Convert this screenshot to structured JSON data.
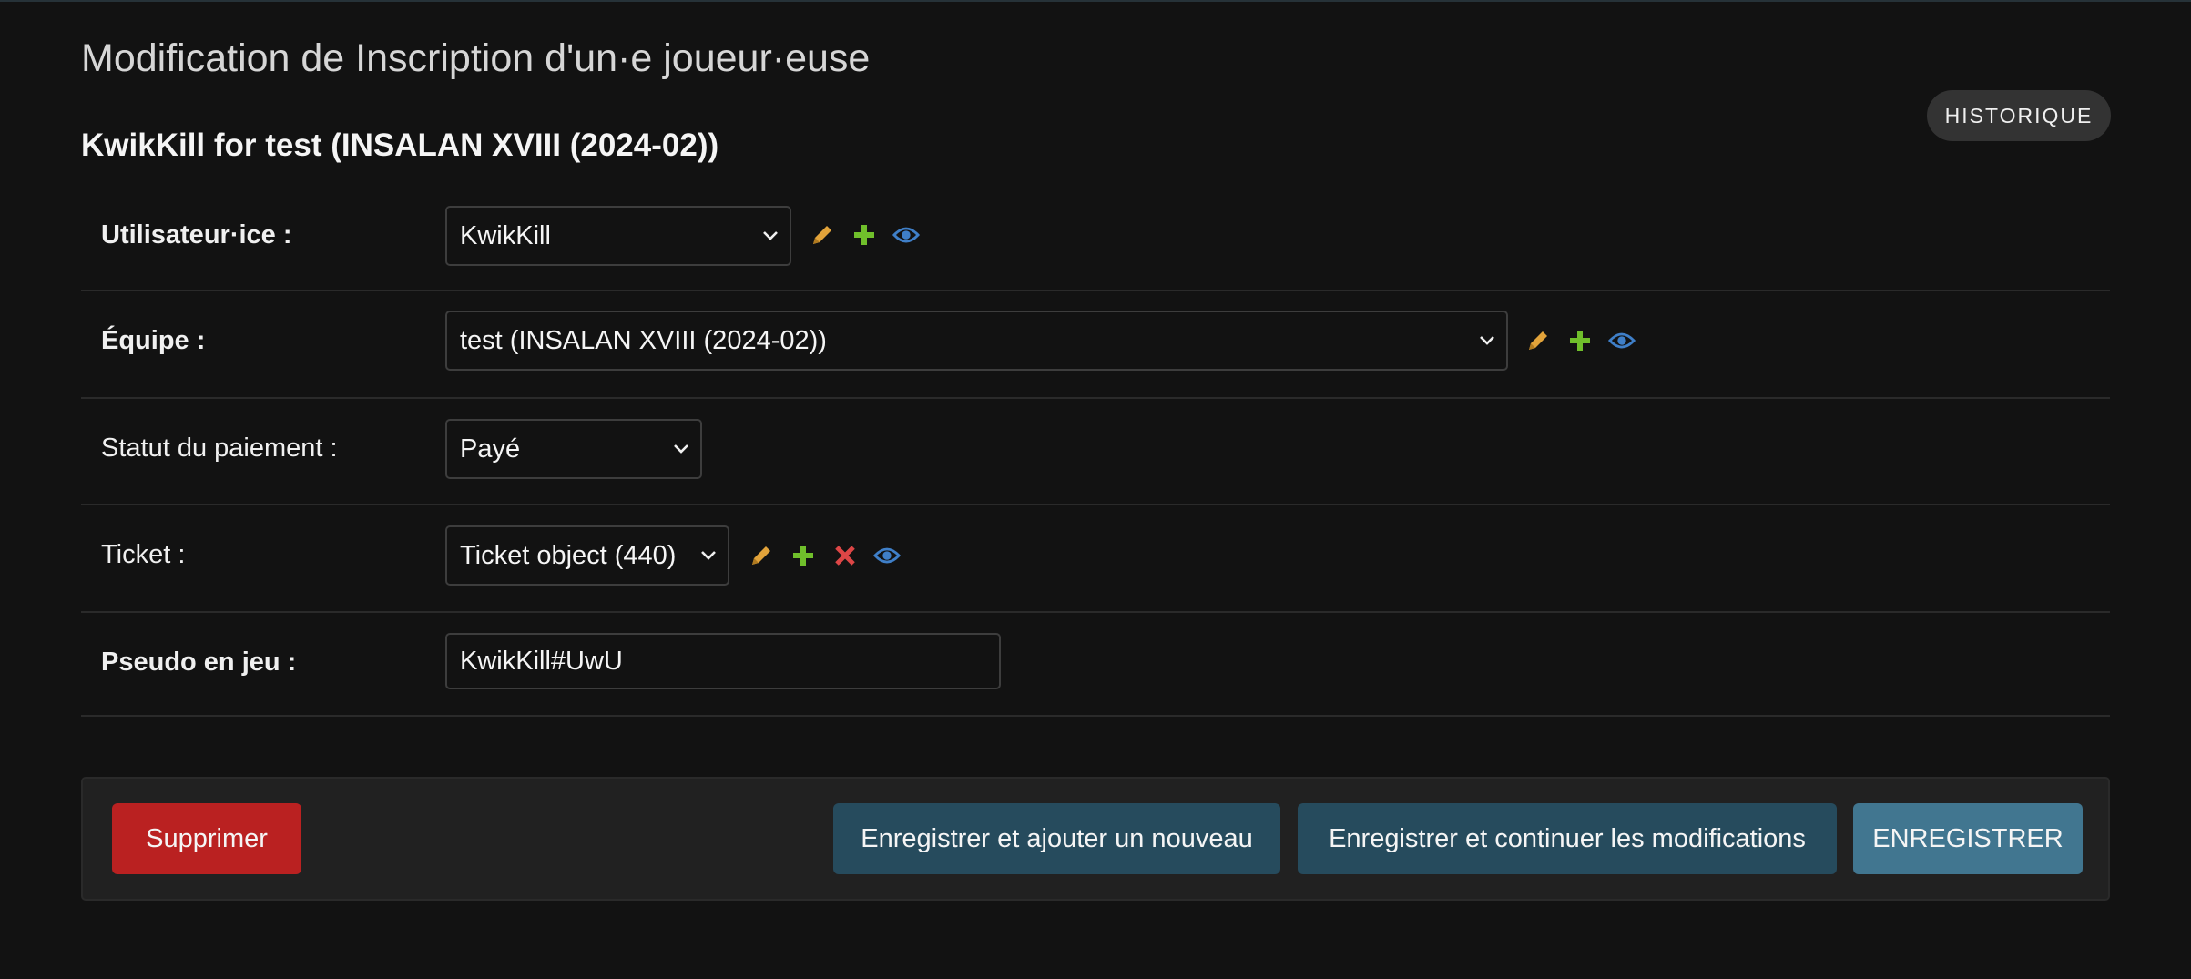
{
  "page": {
    "title": "Modification de Inscription d'un·e joueur·euse",
    "object_title": "KwikKill for test (INSALAN XVIII (2024-02))",
    "history_label": "HISTORIQUE"
  },
  "fields": {
    "user": {
      "label": "Utilisateur·ice :",
      "value": "KwikKill"
    },
    "team": {
      "label": "Équipe :",
      "value": "test (INSALAN XVIII (2024-02))"
    },
    "payment": {
      "label": "Statut du paiement :",
      "value": "Payé"
    },
    "ticket": {
      "label": "Ticket :",
      "value": "Ticket object (440)"
    },
    "ingame": {
      "label": "Pseudo en jeu :",
      "value": "KwikKill#UwU"
    }
  },
  "icons": {
    "edit": "pencil-icon",
    "add": "plus-icon",
    "delete": "x-icon",
    "view": "eye-icon"
  },
  "colors": {
    "edit": "#e2a33a",
    "add": "#70bf2b",
    "delete": "#dd4646",
    "view": "#3f7fc8"
  },
  "buttons": {
    "delete": "Supprimer",
    "save_add": "Enregistrer et ajouter un nouveau",
    "save_continue": "Enregistrer et continuer les modifications",
    "save": "ENREGISTRER"
  }
}
